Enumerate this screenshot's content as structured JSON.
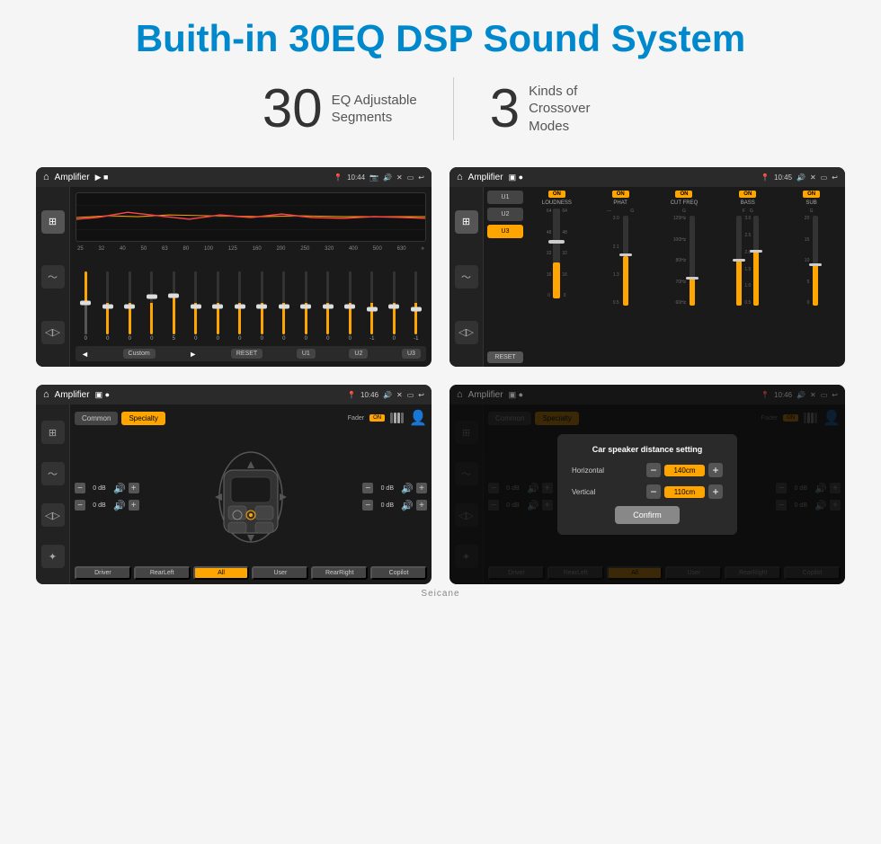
{
  "page": {
    "title": "Buith-in 30EQ DSP Sound System",
    "stats": [
      {
        "number": "30",
        "label": "EQ Adjustable\nSegments"
      },
      {
        "number": "3",
        "label": "Kinds of\nCrossover Modes"
      }
    ]
  },
  "screens": {
    "eq": {
      "topbar": {
        "title": "Amplifier",
        "time": "10:44"
      },
      "eq_labels": [
        "25",
        "32",
        "40",
        "50",
        "63",
        "80",
        "100",
        "125",
        "160",
        "200",
        "250",
        "320",
        "400",
        "500",
        "630"
      ],
      "fader_values": [
        "0",
        "0",
        "0",
        "0",
        "5",
        "0",
        "0",
        "0",
        "0",
        "0",
        "0",
        "0",
        "0",
        "-1",
        "0",
        "-1"
      ],
      "bottom_buttons": [
        "Custom",
        "RESET",
        "U1",
        "U2",
        "U3"
      ]
    },
    "crossover": {
      "topbar": {
        "title": "Amplifier",
        "time": "10:45"
      },
      "channels": [
        {
          "name": "LOUDNESS",
          "on": true
        },
        {
          "name": "PHAT",
          "on": true
        },
        {
          "name": "CUT FREQ",
          "on": true
        },
        {
          "name": "BASS",
          "on": true
        },
        {
          "name": "SUB",
          "on": true
        }
      ],
      "presets": [
        "U1",
        "U2",
        "U3"
      ],
      "reset_label": "RESET"
    },
    "specialty": {
      "topbar": {
        "title": "Amplifier",
        "time": "10:46"
      },
      "tabs": [
        "Common",
        "Specialty"
      ],
      "fader_label": "Fader",
      "fader_on": "ON",
      "db_values": [
        "0 dB",
        "0 dB",
        "0 dB",
        "0 dB"
      ],
      "speaker_buttons": [
        "Driver",
        "RearLeft",
        "All",
        "User",
        "RearRight",
        "Copilot"
      ]
    },
    "dialog": {
      "topbar": {
        "title": "Amplifier",
        "time": "10:46"
      },
      "dialog_title": "Car speaker distance setting",
      "horizontal_label": "Horizontal",
      "horizontal_value": "140cm",
      "vertical_label": "Vertical",
      "vertical_value": "110cm",
      "confirm_label": "Confirm",
      "db_values": [
        "0 dB",
        "0 dB"
      ],
      "speaker_buttons": [
        "Driver",
        "RearLeft",
        "All",
        "User",
        "RearRight",
        "Copilot"
      ]
    }
  },
  "watermark": "Seicane"
}
